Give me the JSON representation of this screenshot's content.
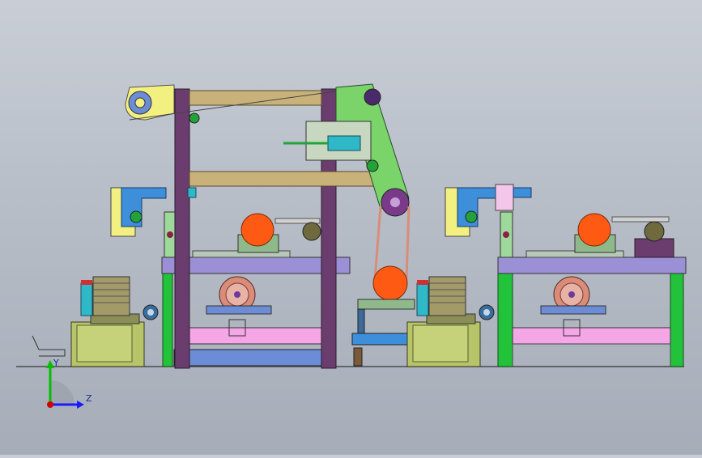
{
  "view": {
    "background_top": "#c9ced6",
    "background_bottom": "#a6adb8"
  },
  "triad": {
    "y_label": "Y",
    "z_label": "Z",
    "y_color": "#00c000",
    "z_color": "#1a1aff",
    "x_color": "#d00000"
  },
  "colors": {
    "frame_purple": "#6a3d6e",
    "plate_lavender": "#9b8fd6",
    "pink_plate": "#f4a6e6",
    "green_frame": "#22c33a",
    "tan_beam": "#c8b27a",
    "motor_orange": "#ff5a14",
    "motor_base_green": "#8fb98a",
    "hydraulic_tank": "#b8c46a",
    "yellow_arm": "#f2f080",
    "blue_bracket": "#3c8fd8"
  },
  "icons": {
    "coordinate_triad": "coordinate-triad-icon"
  }
}
